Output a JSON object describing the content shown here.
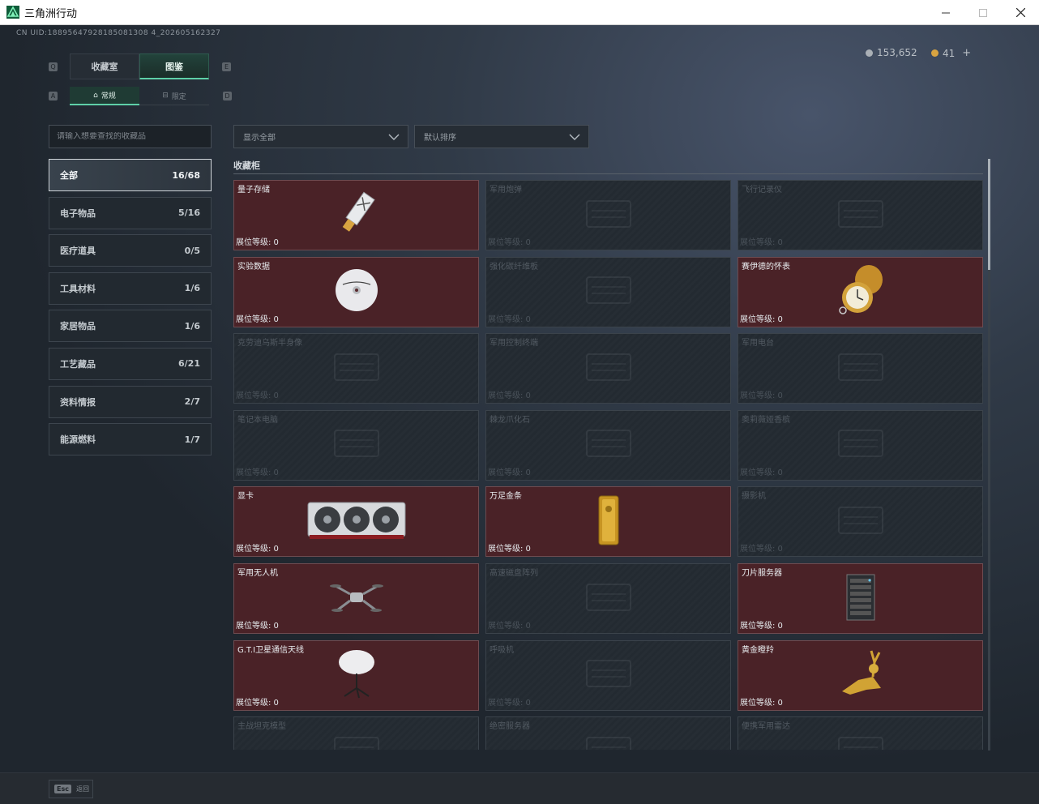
{
  "window": {
    "title": "三角洲行动"
  },
  "header": {
    "uid": "CN UID:18895647928185081308 4_202605162327",
    "currency": [
      {
        "value": "153,652",
        "color": "#aab0b6"
      },
      {
        "value": "41",
        "color": "#d9a441"
      }
    ],
    "plus": "+"
  },
  "tabs": [
    {
      "label": "收藏室",
      "active": false
    },
    {
      "label": "图鉴",
      "active": true
    }
  ],
  "subtabs": [
    {
      "label": "常规",
      "active": true
    },
    {
      "label": "限定",
      "active": false
    }
  ],
  "search": {
    "placeholder": "请输入想要查找的收藏品"
  },
  "filters": {
    "show": "显示全部",
    "sort": "默认排序"
  },
  "categories": [
    {
      "name": "全部",
      "count": "16/68"
    },
    {
      "name": "电子物品",
      "count": "5/16"
    },
    {
      "name": "医疗道具",
      "count": "0/5"
    },
    {
      "name": "工具材料",
      "count": "1/6"
    },
    {
      "name": "家居物品",
      "count": "1/6"
    },
    {
      "name": "工艺藏品",
      "count": "6/21"
    },
    {
      "name": "资料情报",
      "count": "2/7"
    },
    {
      "name": "能源燃料",
      "count": "1/7"
    }
  ],
  "section": {
    "title": "收藏柜"
  },
  "level_label": "展位等级: 0",
  "items": [
    {
      "name": "量子存储",
      "owned": true,
      "icon": "usb-drive-icon"
    },
    {
      "name": "军用炮弹",
      "owned": false,
      "icon": "shell-icon"
    },
    {
      "name": "飞行记录仪",
      "owned": false,
      "icon": "flight-recorder-icon"
    },
    {
      "name": "实验数据",
      "owned": true,
      "icon": "disc-icon"
    },
    {
      "name": "强化碳纤维板",
      "owned": false,
      "icon": "carbon-plate-icon"
    },
    {
      "name": "赛伊德的怀表",
      "owned": true,
      "icon": "pocket-watch-icon"
    },
    {
      "name": "克劳迪乌斯半身像",
      "owned": false,
      "icon": "bust-icon"
    },
    {
      "name": "军用控制终端",
      "owned": false,
      "icon": "terminal-icon"
    },
    {
      "name": "军用电台",
      "owned": false,
      "icon": "radio-icon"
    },
    {
      "name": "笔记本电脑",
      "owned": false,
      "icon": "laptop-icon"
    },
    {
      "name": "棘龙爪化石",
      "owned": false,
      "icon": "fossil-icon"
    },
    {
      "name": "奥莉薇娅香槟",
      "owned": false,
      "icon": "champagne-icon"
    },
    {
      "name": "显卡",
      "owned": true,
      "icon": "graphics-card-icon"
    },
    {
      "name": "万足金条",
      "owned": true,
      "icon": "gold-bar-icon"
    },
    {
      "name": "摄影机",
      "owned": false,
      "icon": "camera-icon"
    },
    {
      "name": "军用无人机",
      "owned": true,
      "icon": "drone-icon"
    },
    {
      "name": "高速磁盘阵列",
      "owned": false,
      "icon": "disk-array-icon"
    },
    {
      "name": "刀片服务器",
      "owned": true,
      "icon": "server-icon"
    },
    {
      "name": "G.T.I卫星通信天线",
      "owned": true,
      "icon": "satellite-dish-icon"
    },
    {
      "name": "呼吸机",
      "owned": false,
      "icon": "ventilator-icon"
    },
    {
      "name": "黄金瞪羚",
      "owned": true,
      "icon": "gold-gazelle-icon"
    },
    {
      "name": "主战坦克模型",
      "owned": false,
      "icon": "tank-model-icon"
    },
    {
      "name": "绝密服务器",
      "owned": false,
      "icon": "secret-server-icon"
    },
    {
      "name": "便携军用雷达",
      "owned": false,
      "icon": "radar-icon"
    }
  ],
  "footer": {
    "esc_key": "Esc",
    "back_label": "返回"
  }
}
